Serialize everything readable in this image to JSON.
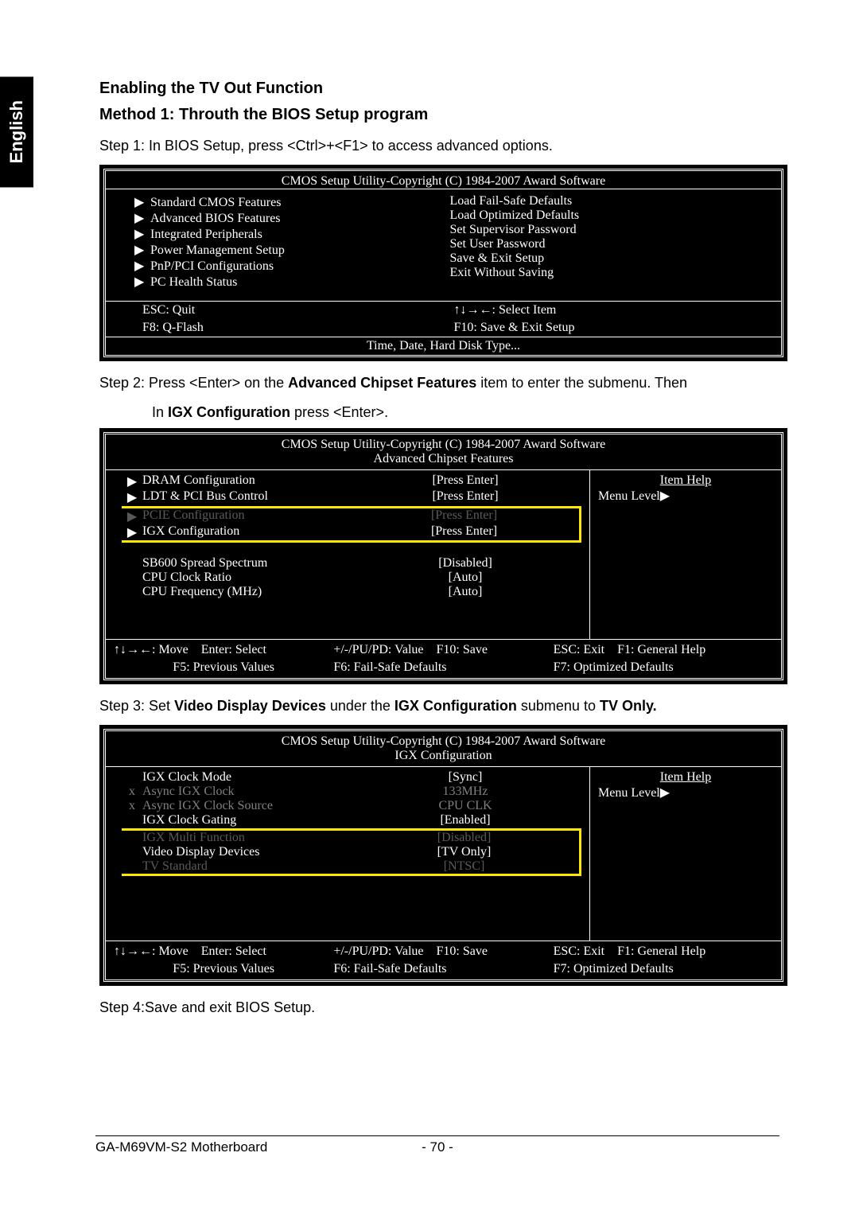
{
  "lang_tab": "English",
  "heading1": "Enabling the TV Out Function",
  "heading2": "Method  1: Throuth the BIOS Setup program",
  "step1": "Step 1: In BIOS Setup, press <Ctrl>+<F1> to access advanced options.",
  "step2_pre": "Step 2:  Press <Enter> on the ",
  "step2_bold1": "Advanced Chipset Features",
  "step2_mid": " item to enter the submenu. Then",
  "step2_line2_pre": "In ",
  "step2_line2_bold": "IGX Configuration",
  "step2_line2_post": " press <Enter>.",
  "step3_pre": "Step 3:  Set ",
  "step3_b1": "Video Display Devices",
  "step3_mid1": " under the ",
  "step3_b2": "IGX Configuration",
  "step3_mid2": " submenu to ",
  "step3_b3": "TV Only.",
  "step4": "Step 4:Save and exit BIOS Setup.",
  "bios1": {
    "title": "CMOS Setup Utility-Copyright (C) 1984-2007 Award Software",
    "left": [
      "Standard CMOS Features",
      "Advanced BIOS Features",
      "Integrated Peripherals",
      "Power Management Setup",
      "PnP/PCI Configurations",
      "PC Health Status"
    ],
    "right": [
      "Load Fail-Safe Defaults",
      "Load Optimized Defaults",
      "Set Supervisor Password",
      "Set User Password",
      "Save & Exit Setup",
      "Exit Without Saving"
    ],
    "help_l1": "ESC: Quit",
    "help_r1": "↑↓→←: Select Item",
    "help_l2": "F8: Q-Flash",
    "help_r2": "F10: Save & Exit Setup",
    "msg": "Time, Date, Hard Disk Type..."
  },
  "bios2": {
    "title": "CMOS Setup Utility-Copyright (C) 1984-2007 Award Software",
    "subtitle": "Advanced Chipset Features",
    "rows_top": [
      {
        "lead": "▶",
        "label": "DRAM Configuration",
        "value": "[Press Enter]"
      },
      {
        "lead": "▶",
        "label": "LDT & PCI Bus Control",
        "value": "[Press Enter]"
      }
    ],
    "row_pcie": {
      "lead": "▶",
      "label": "PCIE Configuration",
      "value": "[Press Enter]"
    },
    "row_igx": {
      "lead": "▶",
      "label": "IGX Configuration",
      "value": "[Press Enter]"
    },
    "rows_bottom": [
      {
        "lead": "",
        "label": "SB600 Spread Spectrum",
        "value": "[Disabled]"
      },
      {
        "lead": "",
        "label": "CPU Clock Ratio",
        "value": "[Auto]"
      },
      {
        "lead": "",
        "label": "CPU Frequency (MHz)",
        "value": "[Auto]"
      }
    ],
    "side_head": "Item Help",
    "side_sub": "Menu Level▶",
    "footer": {
      "a": "↑↓→←: Move",
      "b": "Enter: Select",
      "c": "+/-/PU/PD: Value",
      "d": "F10: Save",
      "e": "ESC: Exit",
      "f": "F1: General Help",
      "g": "F5: Previous Values",
      "h": "F6: Fail-Safe Defaults",
      "i": "F7: Optimized Defaults"
    }
  },
  "bios3": {
    "title": "CMOS Setup Utility-Copyright (C) 1984-2007 Award Software",
    "subtitle": "IGX Configuration",
    "rows_top": [
      {
        "lead": "",
        "label": "IGX Clock Mode",
        "value": "[Sync]"
      },
      {
        "lead": "x",
        "label": "Async IGX Clock",
        "value": "133MHz",
        "grey": true
      },
      {
        "lead": "x",
        "label": "Async IGX Clock Source",
        "value": "CPU   CLK",
        "grey": true
      },
      {
        "lead": "",
        "label": "IGX Clock Gating",
        "value": "[Enabled]"
      }
    ],
    "row_multi": {
      "lead": "",
      "label": "IGX Multi Function",
      "value": "[Disabled]"
    },
    "row_vdd": {
      "lead": "",
      "label": "Video Display Devices",
      "value": "[TV Only]"
    },
    "row_tvs": {
      "lead": "",
      "label": "TV Standard",
      "value": "[NTSC]"
    },
    "side_head": "Item Help",
    "side_sub": "Menu Level▶",
    "footer": {
      "a": "↑↓→←: Move",
      "b": "Enter: Select",
      "c": "+/-/PU/PD: Value",
      "d": "F10: Save",
      "e": "ESC: Exit",
      "f": "F1: General Help",
      "g": "F5: Previous Values",
      "h": "F6: Fail-Safe Defaults",
      "i": "F7: Optimized Defaults"
    }
  },
  "footer": {
    "left": "GA-M69VM-S2 Motherboard",
    "page": "- 70 -"
  }
}
